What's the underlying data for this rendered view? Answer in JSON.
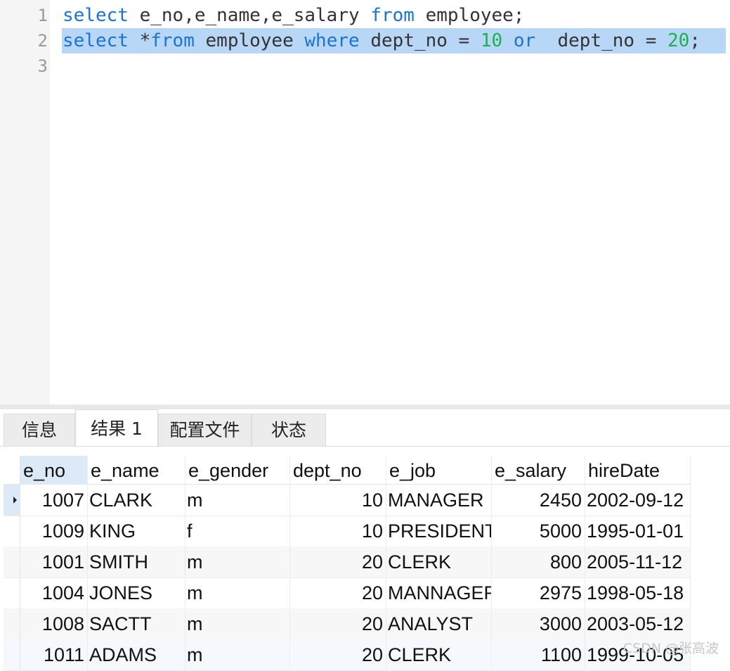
{
  "editor": {
    "line_numbers": [
      "1",
      "2",
      "3"
    ],
    "lines": [
      [
        {
          "t": "select",
          "k": "kw"
        },
        {
          "t": " e_no,e_name,e_salary ",
          "k": ""
        },
        {
          "t": "from",
          "k": "kw"
        },
        {
          "t": " employee;",
          "k": ""
        }
      ],
      [
        {
          "t": "select",
          "k": "kw"
        },
        {
          "t": " *",
          "k": ""
        },
        {
          "t": "from",
          "k": "kw"
        },
        {
          "t": " employee ",
          "k": ""
        },
        {
          "t": "where",
          "k": "kw"
        },
        {
          "t": " dept_no = ",
          "k": ""
        },
        {
          "t": "10",
          "k": "num"
        },
        {
          "t": " ",
          "k": ""
        },
        {
          "t": "or",
          "k": "kw"
        },
        {
          "t": "  dept_no = ",
          "k": ""
        },
        {
          "t": "20",
          "k": "num"
        },
        {
          "t": ";",
          "k": ""
        }
      ],
      []
    ],
    "selected_line": 2
  },
  "tabs": [
    {
      "label": "信息",
      "active": false
    },
    {
      "label": "结果 1",
      "active": true
    },
    {
      "label": "配置文件",
      "active": false
    },
    {
      "label": "状态",
      "active": false
    }
  ],
  "grid": {
    "columns": [
      "e_no",
      "e_name",
      "e_gender",
      "dept_no",
      "e_job",
      "e_salary",
      "hireDate"
    ],
    "rows": [
      [
        "1007",
        "CLARK",
        "m",
        "10",
        "MANAGER",
        "2450",
        "2002-09-12"
      ],
      [
        "1009",
        "KING",
        "f",
        "10",
        "PRESIDENT",
        "5000",
        "1995-01-01"
      ],
      [
        "1001",
        "SMITH",
        "m",
        "20",
        "CLERK",
        "800",
        "2005-11-12"
      ],
      [
        "1004",
        "JONES",
        "m",
        "20",
        "MANNAGER",
        "2975",
        "1998-05-18"
      ],
      [
        "1008",
        "SACTT",
        "m",
        "20",
        "ANALYST",
        "3000",
        "2003-05-12"
      ],
      [
        "1011",
        "ADAMS",
        "m",
        "20",
        "CLERK",
        "1100",
        "1999-10-05"
      ]
    ],
    "current_row": 0
  },
  "watermark": "CSDN @张高波",
  "colors": {
    "keyword": "#1a74d6",
    "number": "#19b34a",
    "selection": "#b8d7f6",
    "row_marker": "#dce9f7"
  }
}
